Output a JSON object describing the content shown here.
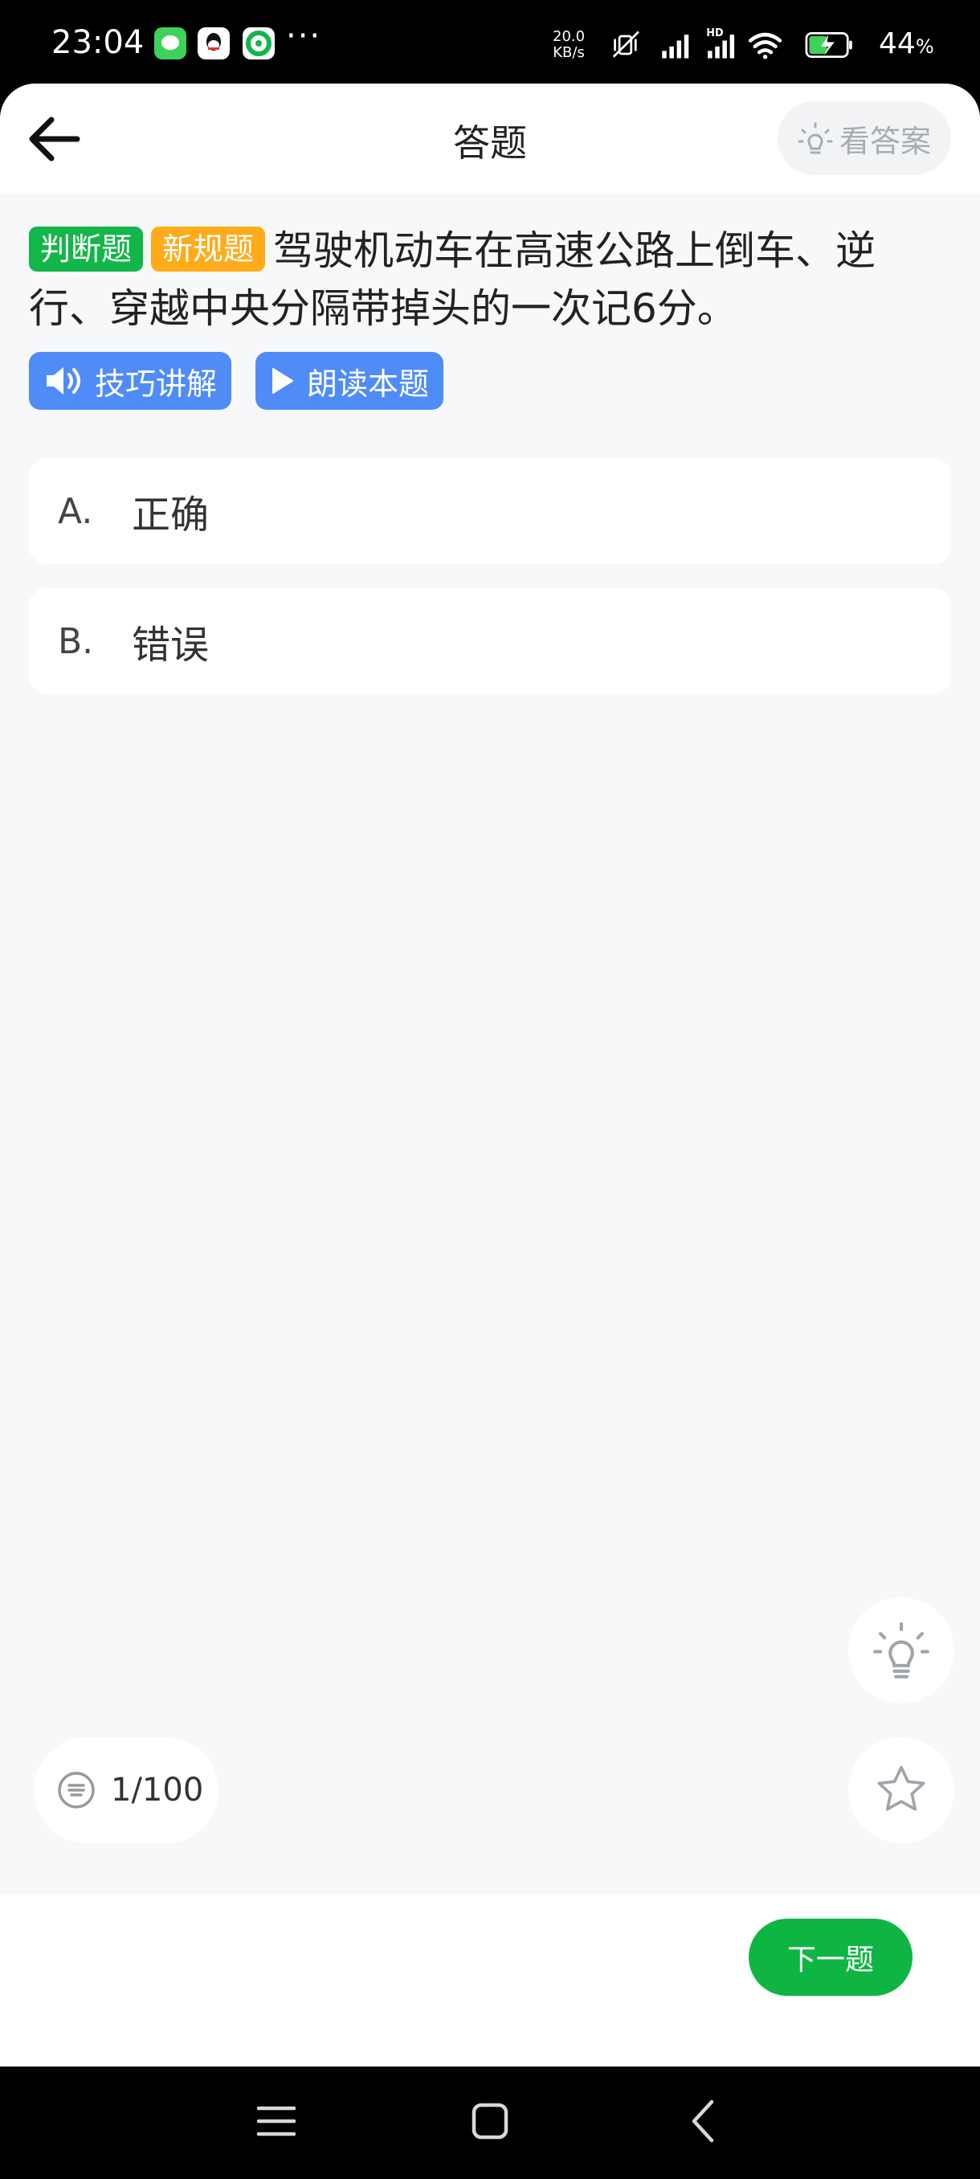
{
  "status_bar": {
    "time": "23:04",
    "notification_more": "···",
    "net_speed_value": "20.0",
    "net_speed_unit": "KB/s",
    "hd_label": "HD",
    "battery_percent": "44",
    "battery_unit": "%"
  },
  "header": {
    "title": "答题",
    "view_answer_label": "看答案"
  },
  "question": {
    "tags": [
      "判断题",
      "新规题"
    ],
    "text": "驾驶机动车在高速公路上倒车、逆行、穿越中央分隔带掉头的一次记6分。",
    "helpers": [
      "技巧讲解",
      "朗读本题"
    ]
  },
  "options": [
    {
      "letter": "A.",
      "text": "正确"
    },
    {
      "letter": "B.",
      "text": "错误"
    }
  ],
  "progress": {
    "counter": "1/100",
    "current": 1,
    "total": 100
  },
  "footer": {
    "next_label": "下一题"
  },
  "icons": {
    "back": "arrow-left-icon",
    "bulb": "lightbulb-icon",
    "star": "star-icon",
    "list": "list-circle-icon",
    "speaker": "speaker-icon",
    "play": "play-icon"
  },
  "colors": {
    "primary_green": "#0fb543",
    "tag_green": "#13b649",
    "tag_orange": "#ffab1a",
    "helper_blue": "#4f8cf7",
    "page_bg": "#f7f8fa"
  }
}
